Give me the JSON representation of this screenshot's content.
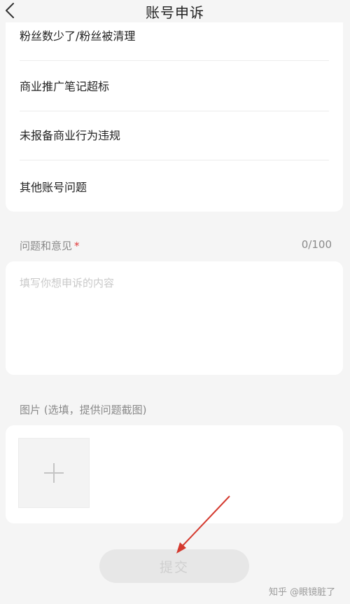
{
  "header": {
    "title": "账号申诉",
    "back_icon": "chevron-left-icon"
  },
  "options": [
    {
      "label": "粉丝数少了/粉丝被清理"
    },
    {
      "label": "商业推广笔记超标"
    },
    {
      "label": "未报备商业行为违规"
    },
    {
      "label": "其他账号问题"
    }
  ],
  "feedback": {
    "label": "问题和意见",
    "required_mark": "*",
    "counter": "0/100",
    "placeholder": "填写你想申诉的内容",
    "value": ""
  },
  "images": {
    "label": "图片 (选填，提供问题截图)",
    "add_icon": "plus-icon"
  },
  "submit": {
    "label": "提交"
  },
  "watermark": {
    "text": "知乎 @眼镜脏了"
  },
  "colors": {
    "required": "#e03a3a",
    "annotation_arrow": "#d43a2f",
    "submit_disabled_bg": "#e7e7e7"
  }
}
